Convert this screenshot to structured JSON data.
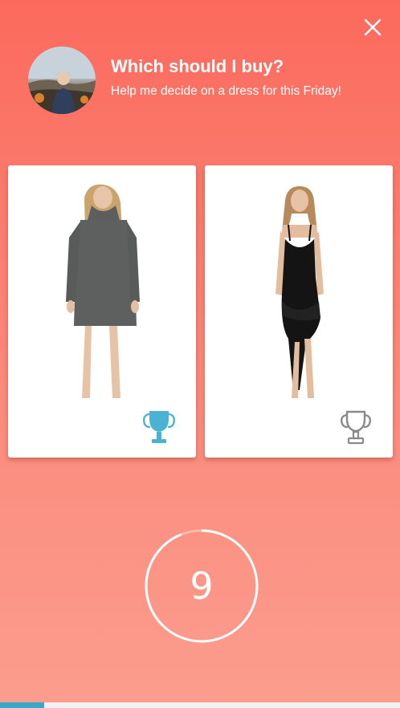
{
  "header": {
    "title": "Which should I buy?",
    "subtitle": "Help me decide on a dress for this Friday!"
  },
  "options": [
    {
      "name": "gray turtleneck sweater dress",
      "vote_state": "selected",
      "trophy_color": "#4ab3d4"
    },
    {
      "name": "black asymmetric slip dress",
      "vote_state": "unselected",
      "trophy_color": "#8a8a8a"
    }
  ],
  "timer": {
    "seconds_left": "9",
    "ring_color": "#ffffff"
  },
  "progress": {
    "fraction": 0.11,
    "color": "#3aa6c8"
  },
  "icons": {
    "close": "close-icon",
    "vote": "trophy-icon"
  }
}
